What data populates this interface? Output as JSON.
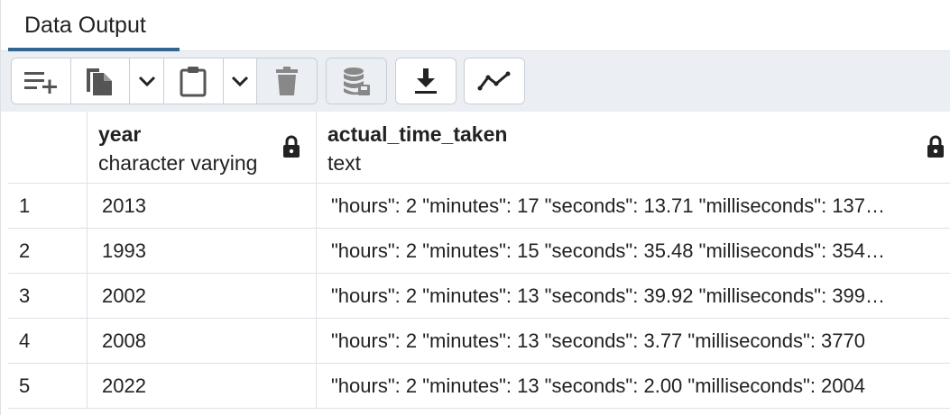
{
  "tabs": [
    {
      "label": "Data Output",
      "active": true
    }
  ],
  "toolbar": {
    "buttons": [
      {
        "icon": "add-row-icon"
      },
      {
        "icon": "copy-icon"
      },
      {
        "icon": "chevron-down-icon"
      },
      {
        "icon": "paste-icon"
      },
      {
        "icon": "chevron-down-icon"
      },
      {
        "icon": "delete-icon"
      },
      {
        "icon": "save-data-icon"
      },
      {
        "icon": "download-icon"
      },
      {
        "icon": "graph-icon"
      }
    ]
  },
  "grid": {
    "columns": [
      {
        "name": "year",
        "type": "character varying",
        "locked": true
      },
      {
        "name": "actual_time_taken",
        "type": "text",
        "locked": true
      }
    ],
    "rows": [
      {
        "num": "1",
        "year": "2013",
        "actual_time_taken": "\"hours\": 2 \"minutes\": 17 \"seconds\": 13.71 \"milliseconds\": 137…"
      },
      {
        "num": "2",
        "year": "1993",
        "actual_time_taken": "\"hours\": 2 \"minutes\": 15 \"seconds\": 35.48 \"milliseconds\": 354…"
      },
      {
        "num": "3",
        "year": "2002",
        "actual_time_taken": "\"hours\": 2 \"minutes\": 13 \"seconds\": 39.92 \"milliseconds\": 399…"
      },
      {
        "num": "4",
        "year": "2008",
        "actual_time_taken": "\"hours\": 2 \"minutes\": 13 \"seconds\": 3.77 \"milliseconds\": 3770"
      },
      {
        "num": "5",
        "year": "2022",
        "actual_time_taken": "\"hours\": 2 \"minutes\": 13 \"seconds\": 2.00 \"milliseconds\": 2004"
      }
    ]
  },
  "colors": {
    "accent": "#326690",
    "toolbar_bg": "#ebeef3",
    "border": "#dde0e6"
  }
}
